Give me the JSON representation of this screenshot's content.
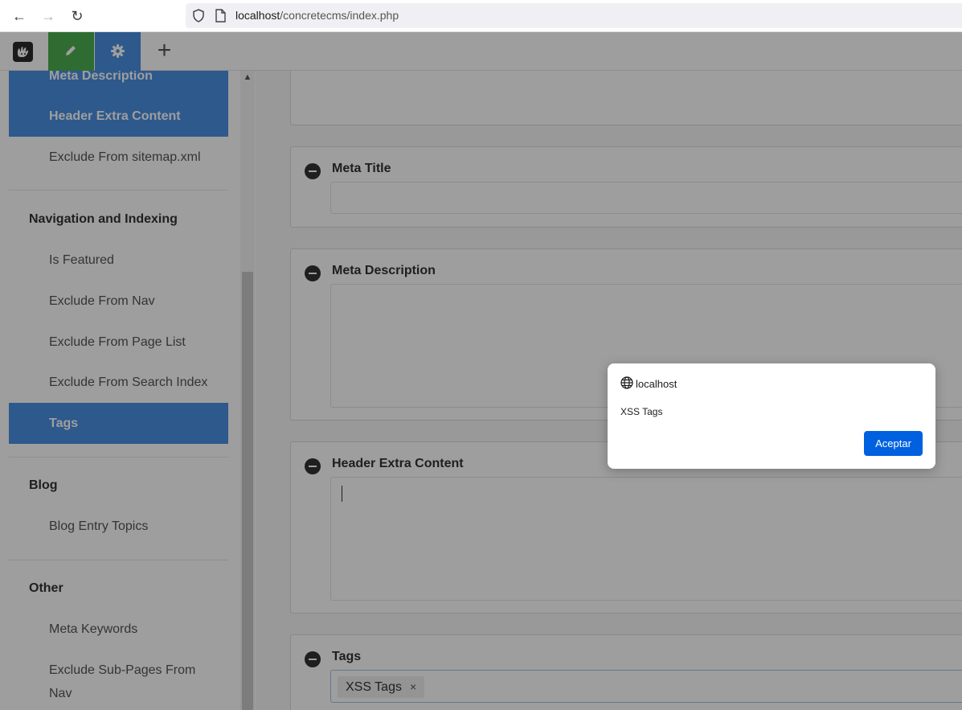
{
  "browser": {
    "back_icon": "←",
    "forward_icon": "→",
    "reload_icon": "↻",
    "url_host": "localhost",
    "url_path": "/concretecms/index.php"
  },
  "toolbar": {
    "add_icon": "+"
  },
  "sidebar": {
    "items_top": [
      {
        "label": "Meta Description",
        "active": true
      },
      {
        "label": "Header Extra Content",
        "active": true
      },
      {
        "label": "Exclude From sitemap.xml",
        "active": false
      }
    ],
    "groups": [
      {
        "title": "Navigation and Indexing",
        "items": [
          "Is Featured",
          "Exclude From Nav",
          "Exclude From Page List",
          "Exclude From Search Index",
          "Tags"
        ]
      },
      {
        "title": "Blog",
        "items": [
          "Blog Entry Topics"
        ]
      },
      {
        "title": "Other",
        "items": [
          "Meta Keywords",
          "Exclude Sub-Pages From Nav"
        ]
      }
    ],
    "exclude_sub_line1": "Exclude Sub-Pages From",
    "exclude_sub_line2": "Nav"
  },
  "main": {
    "meta_title_label": "Meta Title",
    "meta_description_label": "Meta Description",
    "header_extra_label": "Header Extra Content",
    "tags_label": "Tags",
    "tag_value": "XSS Tags",
    "tag_remove": "×"
  },
  "dialog": {
    "origin": "localhost",
    "message": "XSS Tags",
    "ok_label": "Aceptar"
  }
}
